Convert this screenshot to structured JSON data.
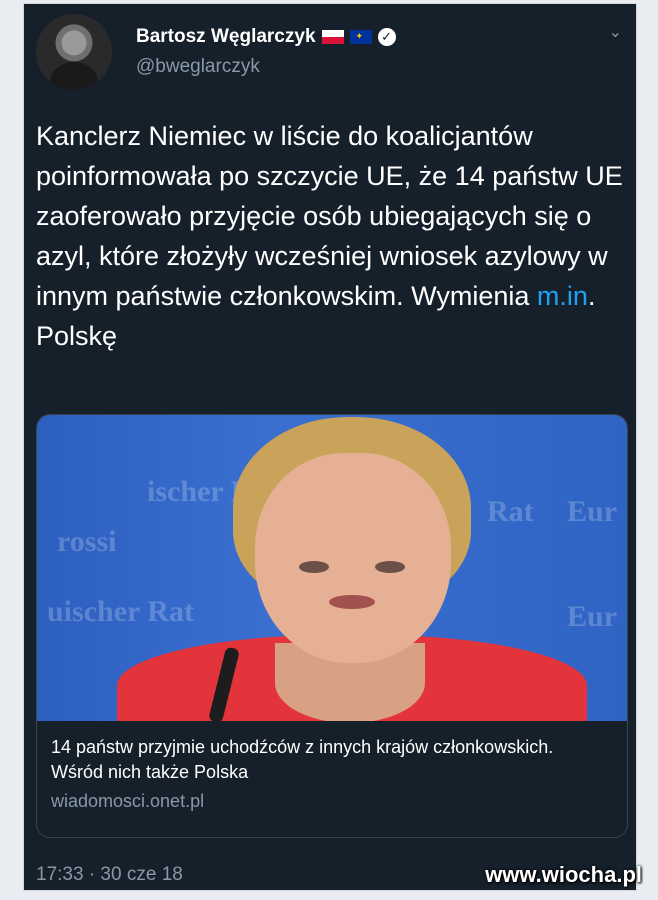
{
  "tweet": {
    "name": "Bartosz Węglarczyk",
    "handle": "@bweglarczyk",
    "text_before_link": "Kanclerz Niemiec w liście do koalicjantów poinformowała po szczycie UE, że 14 państw UE zaoferowało przyjęcie osób ubiegających się o azyl, które złożyły wcześniej wniosek azylowy w innym państwie członkowskim. Wymienia ",
    "link_text": "m.in",
    "text_after_link": ". Polskę",
    "timestamp": "17:33 · 30 cze 18",
    "icons": [
      "flag-poland-icon",
      "flag-eu-icon",
      "verified-icon",
      "chevron-down-icon"
    ]
  },
  "card": {
    "title": "14 państw przyjmie uchodźców z innych krajów członkowskich. Wśród nich także Polska",
    "domain": "wiadomosci.onet.pl"
  },
  "watermark": "www.wiocha.pl",
  "colors": {
    "background": "#15202b",
    "text": "#ffffff",
    "muted": "#8899a6",
    "link": "#1da1f2"
  }
}
